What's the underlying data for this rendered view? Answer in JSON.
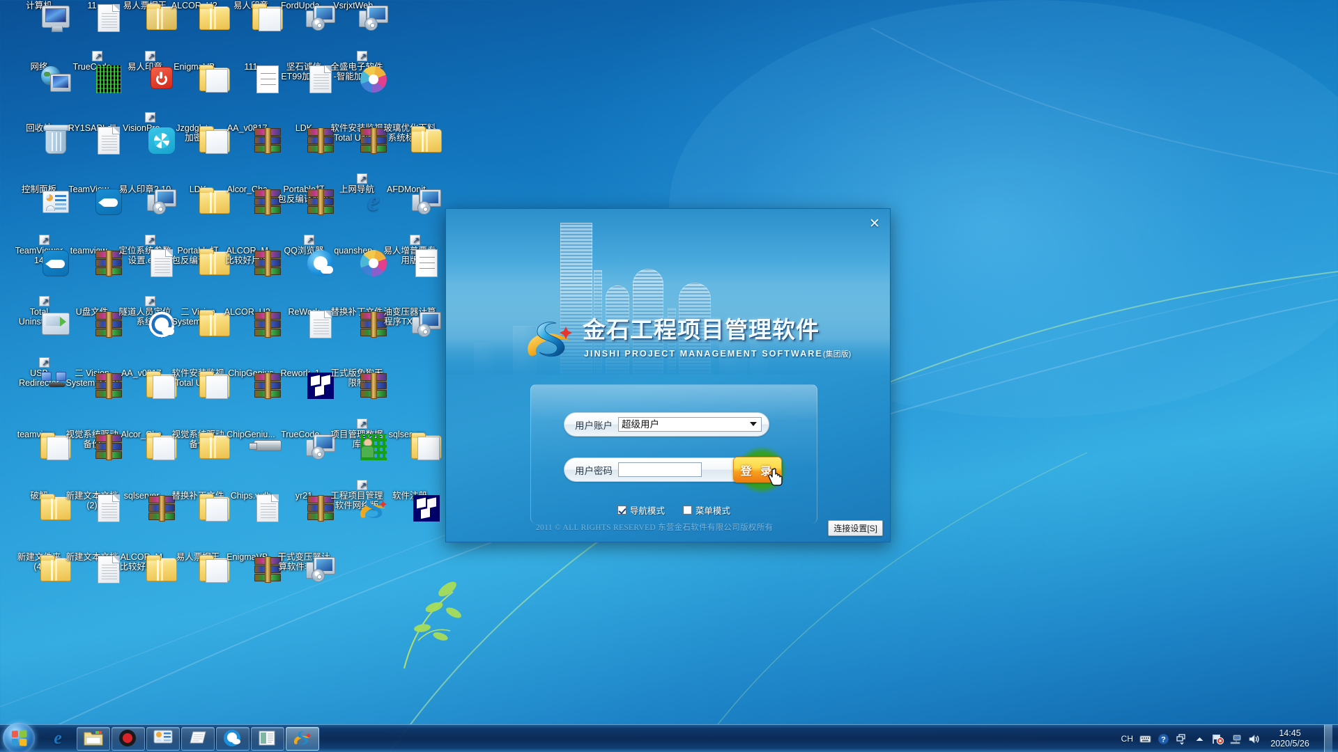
{
  "desktop": {
    "icons": [
      {
        "label": "计算机",
        "label2": "",
        "art": "monitor",
        "shortcut": false
      },
      {
        "label": "11",
        "label2": "",
        "art": "doc-gear",
        "shortcut": false
      },
      {
        "label": "易人票据王",
        "label2": "",
        "art": "ledger",
        "shortcut": true
      },
      {
        "label": "ALCOR_U2...",
        "label2": "",
        "art": "folder",
        "shortcut": false
      },
      {
        "label": "易人印章",
        "label2": "",
        "art": "folder-open",
        "shortcut": false
      },
      {
        "label": "FordUpda...",
        "label2": "",
        "art": "cd",
        "shortcut": false
      },
      {
        "label": "VsrjxtWeb...",
        "label2": "",
        "art": "cd",
        "shortcut": false
      },
      {
        "label": "网络",
        "label2": "",
        "art": "network",
        "shortcut": false
      },
      {
        "label": "TrueCode",
        "label2": "",
        "art": "truecode",
        "shortcut": true
      },
      {
        "label": "易人印章",
        "label2": "",
        "art": "redpower",
        "shortcut": true
      },
      {
        "label": "EnigmaVB...",
        "label2": "",
        "art": "folder-open",
        "shortcut": false
      },
      {
        "label": "111",
        "label2": "",
        "art": "paper-red",
        "shortcut": false
      },
      {
        "label": "坚石诚信",
        "label2": "ET99加密...",
        "art": "doc",
        "shortcut": false
      },
      {
        "label": "全盛电子软件",
        "label2": "-智能加密版",
        "art": "quanshen",
        "shortcut": true
      },
      {
        "label": "回收站",
        "label2": "",
        "art": "bin",
        "shortcut": false
      },
      {
        "label": "RY1SAPI.dll",
        "label2": "",
        "art": "doc-gear",
        "shortcut": false
      },
      {
        "label": "VisionPro...",
        "label2": "",
        "art": "vision",
        "shortcut": true
      },
      {
        "label": "Jzgdglxt_...",
        "label2": "加密狗",
        "art": "folder-open",
        "shortcut": false
      },
      {
        "label": "AA_v0817...",
        "label2": "",
        "art": "rar",
        "shortcut": false
      },
      {
        "label": "LDK",
        "label2": "",
        "art": "rar",
        "shortcut": false
      },
      {
        "label": "软件安装监视",
        "label2": "Total Unin...",
        "art": "rar",
        "shortcut": false
      },
      {
        "label": "玻璃优化下料",
        "label2": "系统标准版",
        "art": "folder",
        "shortcut": false
      },
      {
        "label": "控制面板",
        "label2": "",
        "art": "cpanel",
        "shortcut": false
      },
      {
        "label": "TeamView...",
        "label2": "",
        "art": "teamviewer",
        "shortcut": false
      },
      {
        "label": "易人印章2.10",
        "label2": "",
        "art": "cd",
        "shortcut": false
      },
      {
        "label": "LDK",
        "label2": "",
        "art": "folder",
        "shortcut": false
      },
      {
        "label": "Alcor_Cha...",
        "label2": "",
        "art": "rar",
        "shortcut": false
      },
      {
        "label": "Portable打",
        "label2": "包反编译软件",
        "art": "rar",
        "shortcut": false
      },
      {
        "label": "上网导航",
        "label2": "",
        "art": "ie",
        "shortcut": true
      },
      {
        "label": "AFDMonit...",
        "label2": "",
        "art": "cd",
        "shortcut": false
      },
      {
        "label": "TeamViewer",
        "label2": "14",
        "art": "teamviewer",
        "shortcut": true
      },
      {
        "label": "teamview...",
        "label2": "",
        "art": "rar",
        "shortcut": false
      },
      {
        "label": "定位系统参数",
        "label2": "设置.exe",
        "art": "doc",
        "shortcut": true
      },
      {
        "label": "Portable打",
        "label2": "包反编译软件",
        "art": "folder",
        "shortcut": false
      },
      {
        "label": "ALCOR_M...",
        "label2": "比较好用的...",
        "art": "rar",
        "shortcut": false
      },
      {
        "label": "QQ浏览器",
        "label2": "",
        "art": "qq",
        "shortcut": true
      },
      {
        "label": "quanshen...",
        "label2": "",
        "art": "quanshen",
        "shortcut": false
      },
      {
        "label": "易人增普票专",
        "label2": "用版",
        "art": "paper2",
        "shortcut": true
      },
      {
        "label": "Total",
        "label2": "Uninstall 6",
        "art": "totalunin",
        "shortcut": true
      },
      {
        "label": "U盘文件",
        "label2": "",
        "art": "rar",
        "shortcut": false
      },
      {
        "label": "隧道人员定位",
        "label2": "系统",
        "art": "target",
        "shortcut": true
      },
      {
        "label": "二 Vision",
        "label2": "System_QFN",
        "art": "folder",
        "shortcut": false
      },
      {
        "label": "ALCOR_U2...",
        "label2": "",
        "art": "rar",
        "shortcut": false
      },
      {
        "label": "ReWork",
        "label2": "",
        "art": "doc-gear",
        "shortcut": false
      },
      {
        "label": "替换补丁文件",
        "label2": "",
        "art": "rar",
        "shortcut": false
      },
      {
        "label": "油变压器计算",
        "label2": "程序TXS13...",
        "art": "cd2",
        "shortcut": false
      },
      {
        "label": "USB",
        "label2": "Redirector",
        "art": "usbred",
        "shortcut": true
      },
      {
        "label": "二 Vision",
        "label2": "System_QFN",
        "art": "rar",
        "shortcut": false
      },
      {
        "label": "AA_v0817...",
        "label2": "",
        "art": "folder-open",
        "shortcut": false
      },
      {
        "label": "软件安装监视",
        "label2": "Total Unin...",
        "art": "folder-open",
        "shortcut": false
      },
      {
        "label": "ChipGenius",
        "label2": "",
        "art": "rar",
        "shortcut": false
      },
      {
        "label": "Rework_1...",
        "label2": "",
        "art": "msc",
        "shortcut": false
      },
      {
        "label": "正式版免狗无",
        "label2": "限制",
        "art": "rar",
        "shortcut": false
      },
      {
        "label": "teamview...",
        "label2": "",
        "art": "folder-run",
        "shortcut": false
      },
      {
        "label": "视觉系统驱动",
        "label2": "备份",
        "art": "rar",
        "shortcut": false
      },
      {
        "label": "Alcor_Cha...",
        "label2": "",
        "art": "folder-open",
        "shortcut": false
      },
      {
        "label": "视觉系统驱动",
        "label2": "备份",
        "art": "folder",
        "shortcut": false
      },
      {
        "label": "ChipGeniu...",
        "label2": "",
        "art": "usb",
        "shortcut": false
      },
      {
        "label": "TrueCode...",
        "label2": "",
        "art": "cd",
        "shortcut": false
      },
      {
        "label": "项目管理数据",
        "label2": "库",
        "art": "qr-person",
        "shortcut": true
      },
      {
        "label": "sqlserver...",
        "label2": "",
        "art": "folder-open",
        "shortcut": false
      },
      {
        "label": "破解",
        "label2": "",
        "art": "folder",
        "shortcut": false
      },
      {
        "label": "新建文本文档",
        "label2": "(2)",
        "art": "doc",
        "shortcut": false
      },
      {
        "label": "sqlserver...",
        "label2": "",
        "art": "rar",
        "shortcut": false
      },
      {
        "label": "替换补丁文件",
        "label2": "",
        "art": "folder-open",
        "shortcut": false
      },
      {
        "label": "Chips.wdb",
        "label2": "",
        "art": "blank-doc",
        "shortcut": false
      },
      {
        "label": "yr21",
        "label2": "",
        "art": "rar",
        "shortcut": false
      },
      {
        "label": "工程项目管理",
        "label2": "软件网络版",
        "art": "jinshi",
        "shortcut": true
      },
      {
        "label": "软件注册",
        "label2": "",
        "art": "msc",
        "shortcut": false
      },
      {
        "label": "新建文件夹",
        "label2": "(4)",
        "art": "folder",
        "shortcut": false
      },
      {
        "label": "新建文本文档",
        "label2": "",
        "art": "doc",
        "shortcut": false
      },
      {
        "label": "ALCOR_M...",
        "label2": "比较好用的...",
        "art": "folder",
        "shortcut": false
      },
      {
        "label": "易人票据王",
        "label2": "",
        "art": "folder-open",
        "shortcut": false
      },
      {
        "label": "EnigmaVB...",
        "label2": "",
        "art": "rar",
        "shortcut": false
      },
      {
        "label": "干式变压器计",
        "label2": "算软件软件...",
        "art": "cd2",
        "shortcut": false
      }
    ]
  },
  "login": {
    "title_cn": "金石工程项目管理软件",
    "title_en": "JINSHI PROJECT MANAGEMENT SOFTWARE",
    "title_edition": "(集团版)",
    "close_label": "✕",
    "account_label": "用户账户",
    "account_value": "超级用户",
    "password_label": "用户密码",
    "password_value": "",
    "login_button": "登 录",
    "nav_mode_label": "导航模式",
    "nav_mode_checked": true,
    "menu_mode_label": "菜单模式",
    "menu_mode_checked": false,
    "copyright": "2011  ©    ALL  RIGHTS  RESERVED  东营金石软件有限公司版权所有",
    "connection_settings": "连接设置[S]"
  },
  "taskbar": {
    "start_tooltip": "开始",
    "buttons": [
      {
        "name": "internet-explorer",
        "icon": "ie-icon",
        "framed": false,
        "active": false
      },
      {
        "name": "windows-explorer",
        "icon": "folder-icon",
        "framed": true,
        "active": false
      },
      {
        "name": "recorder",
        "icon": "record-icon",
        "framed": true,
        "active": false
      },
      {
        "name": "control-panel-window",
        "icon": "cpanel-icon",
        "framed": true,
        "active": false
      },
      {
        "name": "notepad-window",
        "icon": "notepad-icon",
        "framed": true,
        "active": false
      },
      {
        "name": "qq-browser-window",
        "icon": "qq-icon",
        "framed": true,
        "active": false
      },
      {
        "name": "document-window",
        "icon": "document-icon",
        "framed": true,
        "active": false
      },
      {
        "name": "jinshi-window",
        "icon": "jinshi-icon",
        "framed": true,
        "active": true
      }
    ],
    "tray": {
      "ime": "CH",
      "icons": [
        "keyboard-icon",
        "help-icon",
        "window-stack-icon",
        "show-hidden-icon",
        "action-center-flag-icon",
        "network-icon",
        "volume-icon"
      ],
      "time": "14:45",
      "date": "2020/5/26"
    }
  }
}
